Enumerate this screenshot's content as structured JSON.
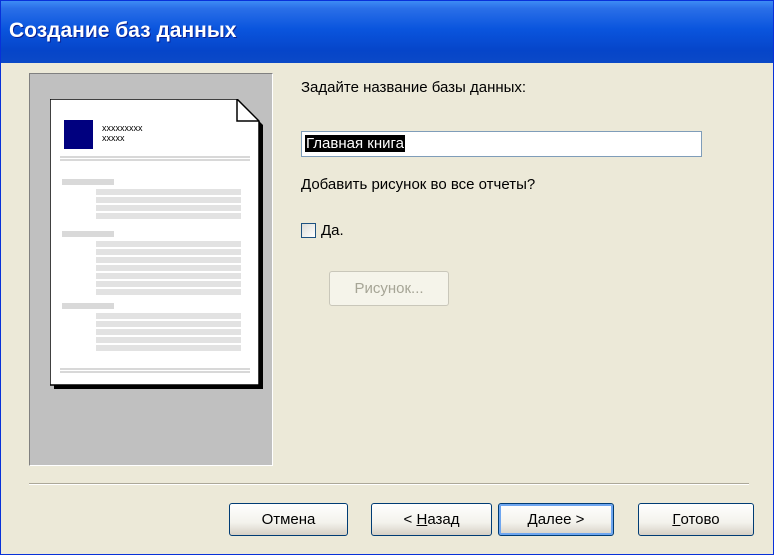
{
  "window": {
    "title": "Создание баз данных"
  },
  "preview": {
    "header_line1": "xxxxxxxxx",
    "header_line2": "xxxxx"
  },
  "form": {
    "name_prompt": "Задайте название базы данных:",
    "name_value": "Главная книга",
    "picture_question": "Добавить рисунок во все отчеты?",
    "picture_checkbox_label": "Да.",
    "picture_checkbox_checked": false,
    "picture_button_label": "Рисунок..."
  },
  "buttons": {
    "cancel": "Отмена",
    "back_prefix": "< ",
    "back_hotkey": "Н",
    "back_rest": "азад",
    "next_hotkey": "Д",
    "next_rest": "алее >",
    "finish_hotkey": "Г",
    "finish_rest": "отово"
  },
  "colors": {
    "titlebar": "#0a55de",
    "accent_square": "#00007f"
  }
}
